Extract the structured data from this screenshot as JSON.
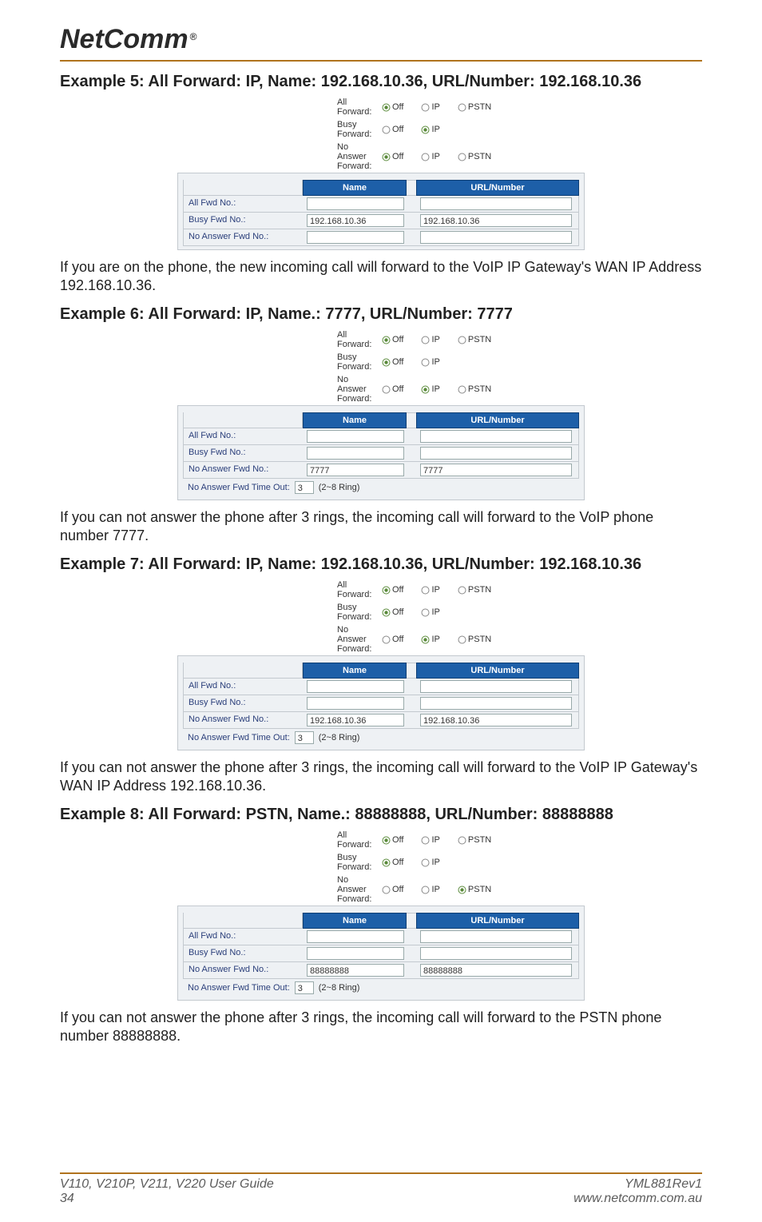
{
  "logo": "NetComm",
  "examples": [
    {
      "heading": "Example 5: All Forward: IP, Name: 192.168.10.36, URL/Number: 192.168.10.36",
      "forwards": [
        {
          "label": "All Forward:",
          "off": true,
          "ip": false,
          "pstn": false,
          "show_pstn": true
        },
        {
          "label": "Busy Forward:",
          "off": false,
          "ip": true,
          "pstn": false,
          "show_pstn": false
        },
        {
          "label": "No Answer Forward:",
          "off": true,
          "ip": false,
          "pstn": false,
          "show_pstn": true
        }
      ],
      "headers": {
        "name": "Name",
        "url": "URL/Number"
      },
      "rows": [
        {
          "label": "All Fwd No.:",
          "name": "",
          "url": ""
        },
        {
          "label": "Busy Fwd No.:",
          "name": "192.168.10.36",
          "url": "192.168.10.36"
        },
        {
          "label": "No Answer Fwd No.:",
          "name": "",
          "url": ""
        }
      ],
      "has_timeout": false,
      "para": "If you are on the phone, the new incoming call will forward to the VoIP IP Gateway's WAN IP Address 192.168.10.36."
    },
    {
      "heading": "Example 6: All Forward: IP, Name.: 7777, URL/Number: 7777",
      "forwards": [
        {
          "label": "All Forward:",
          "off": true,
          "ip": false,
          "pstn": false,
          "show_pstn": true
        },
        {
          "label": "Busy Forward:",
          "off": true,
          "ip": false,
          "pstn": false,
          "show_pstn": false
        },
        {
          "label": "No Answer Forward:",
          "off": false,
          "ip": true,
          "pstn": false,
          "show_pstn": true
        }
      ],
      "headers": {
        "name": "Name",
        "url": "URL/Number"
      },
      "rows": [
        {
          "label": "All Fwd No.:",
          "name": "",
          "url": ""
        },
        {
          "label": "Busy Fwd No.:",
          "name": "",
          "url": ""
        },
        {
          "label": "No Answer Fwd No.:",
          "name": "7777",
          "url": "7777"
        }
      ],
      "has_timeout": true,
      "timeout": {
        "label": "No Answer Fwd Time Out:",
        "value": "3",
        "note": "(2~8 Ring)"
      },
      "para": "If you can not answer the phone after 3 rings, the incoming call will forward to the VoIP phone number 7777."
    },
    {
      "heading": "Example 7: All Forward: IP, Name: 192.168.10.36, URL/Number: 192.168.10.36",
      "forwards": [
        {
          "label": "All Forward:",
          "off": true,
          "ip": false,
          "pstn": false,
          "show_pstn": true
        },
        {
          "label": "Busy Forward:",
          "off": true,
          "ip": false,
          "pstn": false,
          "show_pstn": false
        },
        {
          "label": "No Answer Forward:",
          "off": false,
          "ip": true,
          "pstn": false,
          "show_pstn": true
        }
      ],
      "headers": {
        "name": "Name",
        "url": "URL/Number"
      },
      "rows": [
        {
          "label": "All Fwd No.:",
          "name": "",
          "url": ""
        },
        {
          "label": "Busy Fwd No.:",
          "name": "",
          "url": ""
        },
        {
          "label": "No Answer Fwd No.:",
          "name": "192.168.10.36",
          "url": "192.168.10.36"
        }
      ],
      "has_timeout": true,
      "timeout": {
        "label": "No Answer Fwd Time Out:",
        "value": "3",
        "note": "(2~8 Ring)"
      },
      "para": "If you can not answer the phone after 3 rings, the incoming call will forward to the VoIP IP Gateway's WAN IP Address 192.168.10.36."
    },
    {
      "heading": "Example 8: All Forward: PSTN, Name.: 88888888, URL/Number: 88888888",
      "forwards": [
        {
          "label": "All Forward:",
          "off": true,
          "ip": false,
          "pstn": false,
          "show_pstn": true
        },
        {
          "label": "Busy Forward:",
          "off": true,
          "ip": false,
          "pstn": false,
          "show_pstn": false
        },
        {
          "label": "No Answer Forward:",
          "off": false,
          "ip": false,
          "pstn": true,
          "show_pstn": true
        }
      ],
      "headers": {
        "name": "Name",
        "url": "URL/Number"
      },
      "rows": [
        {
          "label": "All Fwd No.:",
          "name": "",
          "url": ""
        },
        {
          "label": "Busy Fwd No.:",
          "name": "",
          "url": ""
        },
        {
          "label": "No Answer Fwd No.:",
          "name": "88888888",
          "url": "88888888"
        }
      ],
      "has_timeout": true,
      "timeout": {
        "label": "No Answer Fwd Time Out:",
        "value": "3",
        "note": "(2~8 Ring)"
      },
      "para": "If you can not answer the phone after 3 rings, the incoming call will forward to the PSTN phone number 88888888."
    }
  ],
  "radio_labels": {
    "off": "Off",
    "ip": "IP",
    "pstn": "PSTN"
  },
  "footer": {
    "left_line1": "V110, V210P, V211, V220 User Guide",
    "left_line2": "34",
    "right_line1": "YML881Rev1",
    "right_line2": "www.netcomm.com.au"
  }
}
